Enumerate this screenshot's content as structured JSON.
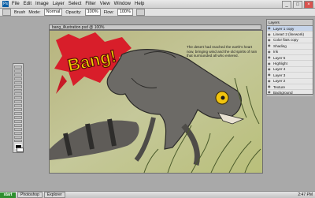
{
  "app": {
    "title": "Adobe Photoshop - [bang_illustration.psd @ 100% (Layer 1, RGB/8)]",
    "menu": [
      "File",
      "Edit",
      "Image",
      "Layer",
      "Select",
      "Filter",
      "View",
      "Window",
      "Help"
    ],
    "window_buttons": [
      "_",
      "□",
      "×"
    ]
  },
  "options_bar": {
    "tool_preset": "Brush",
    "mode_label": "Mode:",
    "mode_value": "Normal",
    "opacity_label": "Opacity:",
    "opacity_value": "100%",
    "flow_label": "Flow:",
    "flow_value": "100%"
  },
  "document": {
    "tab_title": "bang_illustration.psd @ 100%",
    "bang_text": "Bang!",
    "caption": "The desert had reached the earth's heart now, bringing wind and the old spirits of rain that surrounded all who entered."
  },
  "layers_panel": {
    "title": "Layers",
    "items": [
      {
        "name": "Layer 1 copy"
      },
      {
        "name": "Lineart 2 (linework)"
      },
      {
        "name": "Color flats copy"
      },
      {
        "name": "Shading"
      },
      {
        "name": "Ink"
      },
      {
        "name": "Layer 5"
      },
      {
        "name": "Highlight"
      },
      {
        "name": "Layer 4"
      },
      {
        "name": "Layer 3"
      },
      {
        "name": "Layer 2"
      },
      {
        "name": "Texture"
      },
      {
        "name": "Background"
      }
    ],
    "active_index": 0
  },
  "taskbar": {
    "start_label": "start",
    "tasks": [
      "Photoshop",
      "Explorer"
    ],
    "clock": "2:47 PM"
  },
  "colors": {
    "canvas_bg": "#c9cb98",
    "splash_red": "#d81e2a",
    "bang_yellow": "#f2d000",
    "creature": "#6c6a66",
    "eye": "#f1c40f"
  }
}
